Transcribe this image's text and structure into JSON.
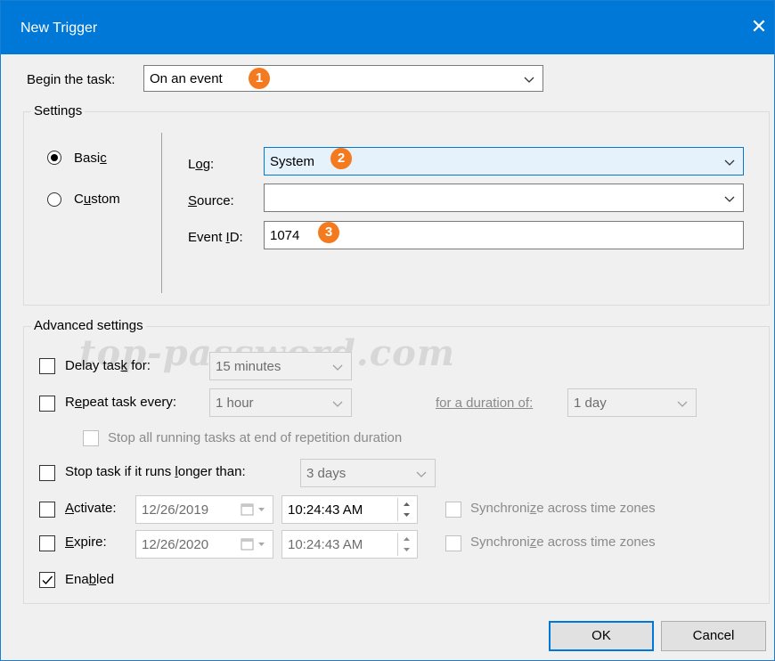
{
  "window": {
    "title": "New Trigger",
    "close_glyph": "✕"
  },
  "begin_task": {
    "label_pre": "Be",
    "label_key": "g",
    "label_post": "in the task:",
    "value": "On an event",
    "badge": "1"
  },
  "settings": {
    "group_label": "Settings",
    "basic_pre": "Basi",
    "basic_key": "c",
    "custom_pre": "C",
    "custom_key": "u",
    "custom_post": "stom",
    "selected": "basic",
    "log": {
      "label_pre": "L",
      "label_key": "o",
      "label_post": "g:",
      "value": "System",
      "badge": "2"
    },
    "source": {
      "label_key": "S",
      "label_post": "ource:",
      "value": ""
    },
    "event_id": {
      "label_pre": "Event ",
      "label_key": "I",
      "label_post": "D:",
      "value": "1074",
      "badge": "3"
    }
  },
  "advanced": {
    "group_label": "Advanced settings",
    "watermark": "top-password.com",
    "delay": {
      "label_pre": "Delay tas",
      "label_key": "k",
      "label_post": " for:",
      "value": "15 minutes",
      "checked": false
    },
    "repeat": {
      "label_pre": "R",
      "label_key": "e",
      "label_post": "peat task every:",
      "value": "1 hour",
      "checked": false,
      "duration_label_pre": "f",
      "duration_label_key": "",
      "duration_label": "for a duration of:",
      "duration_value": "1 day"
    },
    "stop_all": {
      "label": "Stop all running tasks at end of repetition duration",
      "checked": false
    },
    "stop_longer": {
      "label_pre": "Stop task if it runs ",
      "label_key": "l",
      "label_post": "onger than:",
      "value": "3 days",
      "checked": false
    },
    "activate": {
      "label_key": "A",
      "label_post": "ctivate:",
      "date": "12/26/2019",
      "time": "10:24:43 AM",
      "checked": false,
      "sync_pre": "Synchroni",
      "sync_key": "z",
      "sync_post": "e across time zones"
    },
    "expire": {
      "label_key": "E",
      "label_post": "xpire:",
      "date": "12/26/2020",
      "time": "10:24:43 AM",
      "checked": false,
      "sync_pre": "Synchroni",
      "sync_key": "z",
      "sync_post": "e across time zones"
    },
    "enabled": {
      "label_pre": "Ena",
      "label_key": "b",
      "label_post": "led",
      "checked": true
    }
  },
  "buttons": {
    "ok": "OK",
    "cancel": "Cancel"
  },
  "colors": {
    "titlebar": "#0078d7",
    "badge": "#f47a20",
    "highlight_field": "#e5f1fb"
  }
}
